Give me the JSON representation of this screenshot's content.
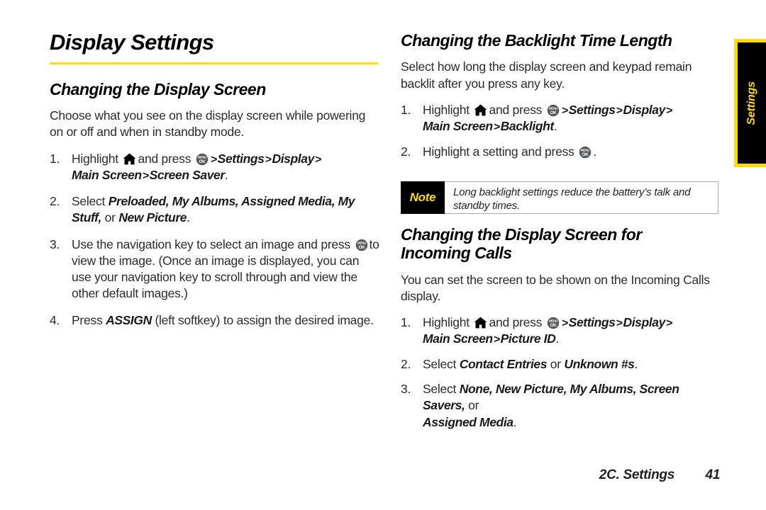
{
  "page": {
    "title": "Display Settings",
    "accent_color": "#ffdd00",
    "text_color": "#231f20"
  },
  "side_tab": {
    "label": "Settings",
    "background": "#000000",
    "border_color": "#ffdd00",
    "text_color": "#ffdd00"
  },
  "footer": {
    "chapter": "2C. Settings",
    "page_number": "41"
  },
  "left_column": {
    "heading": "Changing the Display Screen",
    "intro": "Choose what you see on the display screen while powering on or off and when in standby mode.",
    "steps": [
      {
        "num": "1.",
        "t1": "Highlight",
        "icon_home": "home-icon",
        "t2": "and press",
        "icon_ok": "menu-ok-icon",
        "gt1": ">",
        "path1": "Settings",
        "gt2": ">",
        "path2": "Display",
        "gt3": ">",
        "path3": "Main Screen",
        "gt4": ">",
        "path4": "Screen Saver",
        "tail": "."
      },
      {
        "num": "2.",
        "t1": "Select",
        "em1": "Preloaded, My Albums, Assigned Media, My Stuff,",
        "t2": "or",
        "em2": "New Picture",
        "tail": "."
      },
      {
        "num": "3.",
        "t1": "Use the navigation key to select an image and press",
        "icon_ok": "menu-ok-icon",
        "t2": "to view the image. (Once an image is displayed, you can use your navigation key to scroll through and view the other default images.)"
      },
      {
        "num": "4.",
        "t1": "Press",
        "em1": "ASSIGN",
        "t2": "(left softkey)  to assign the desired image."
      }
    ]
  },
  "right_column": {
    "section_backlight": {
      "heading": "Changing the Backlight Time Length",
      "intro": "Select how long the display screen and keypad remain backlit after you press any key.",
      "steps": [
        {
          "num": "1.",
          "t1": "Highlight",
          "icon_home": "home-icon",
          "t2": "and press",
          "icon_ok": "menu-ok-icon",
          "gt1": ">",
          "path1": "Settings",
          "gt2": ">",
          "path2": "Display",
          "gt3": ">",
          "path3": "Main Screen",
          "gt4": ">",
          "path4": "Backlight",
          "tail": "."
        },
        {
          "num": "2.",
          "t1": "Highlight a setting and press",
          "icon_ok": "menu-ok-icon",
          "tail": "."
        }
      ]
    },
    "note": {
      "label": "Note",
      "text": "Long backlight settings reduce the battery’s talk and standby times."
    },
    "section_incoming": {
      "heading_line1": "Changing the Display Screen for",
      "heading_line2": "Incoming Calls",
      "intro": "You can set the screen to be shown on the Incoming Calls display.",
      "steps": [
        {
          "num": "1.",
          "t1": "Highlight",
          "icon_home": "home-icon",
          "t2": "and press",
          "icon_ok": "menu-ok-icon",
          "gt1": ">",
          "path1": "Settings",
          "gt2": ">",
          "path2": "Display",
          "gt3": ">",
          "path3": "Main Screen",
          "gt4": ">",
          "path4": "Picture ID",
          "tail": "."
        },
        {
          "num": "2.",
          "t1": "Select",
          "em1": "Contact Entries",
          "t2": "or",
          "em2": "Unknown #s",
          "tail": "."
        },
        {
          "num": "3.",
          "t1": "Select",
          "em1": "None, New Picture, My Albums, Screen Savers,",
          "t2": "or",
          "em2": "Assigned Media",
          "tail": "."
        }
      ]
    }
  }
}
